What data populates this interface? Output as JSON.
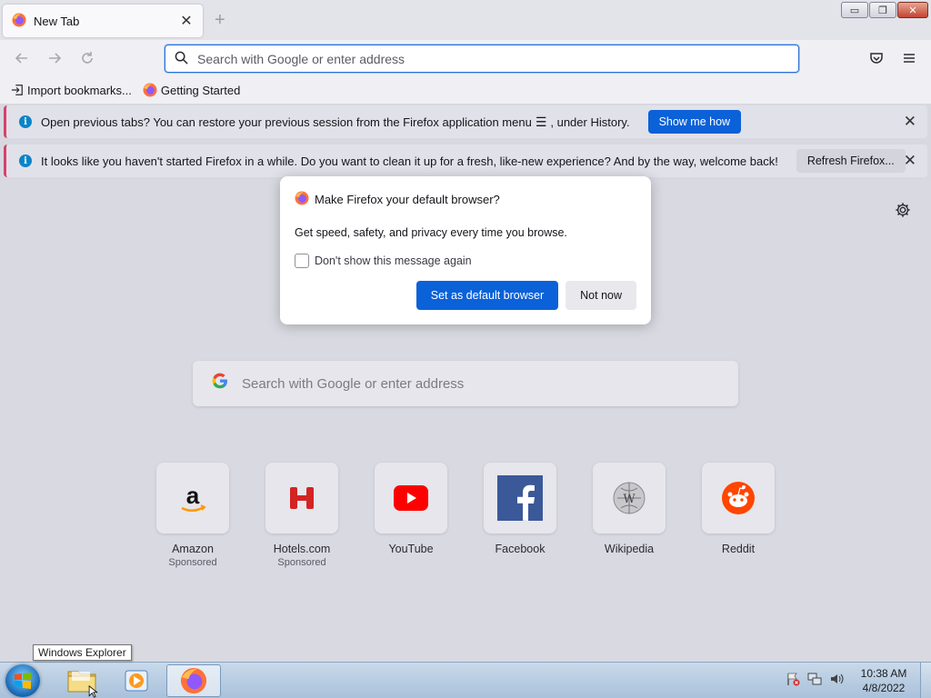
{
  "tab": {
    "title": "New Tab",
    "close": "✕",
    "new": "+"
  },
  "window_controls": {
    "minimize": "▭",
    "maximize": "❐",
    "close": "✕"
  },
  "urlbar": {
    "placeholder": "Search with Google or enter address"
  },
  "bookmarks": [
    {
      "label": "Import bookmarks...",
      "icon": "import-icon"
    },
    {
      "label": "Getting Started",
      "icon": "firefox-icon"
    }
  ],
  "notifications": [
    {
      "message": "Open previous tabs? You can restore your previous session from the Firefox application menu",
      "message_suffix": ", under History.",
      "button": "Show me how"
    },
    {
      "message": "It looks like you haven't started Firefox in a while. Do you want to clean it up for a fresh, like-new experience? And by the way, welcome back!",
      "button": "Refresh Firefox..."
    }
  ],
  "dialog": {
    "title": "Make Firefox your default browser?",
    "body": "Get speed, safety, and privacy every time you browse.",
    "checkbox_label": "Don't show this message again",
    "primary_button": "Set as default browser",
    "secondary_button": "Not now"
  },
  "page_search": {
    "placeholder": "Search with Google or enter address"
  },
  "top_sites": [
    {
      "name": "Amazon",
      "sponsored": "Sponsored"
    },
    {
      "name": "Hotels.com",
      "sponsored": "Sponsored"
    },
    {
      "name": "YouTube",
      "sponsored": ""
    },
    {
      "name": "Facebook",
      "sponsored": ""
    },
    {
      "name": "Wikipedia",
      "sponsored": ""
    },
    {
      "name": "Reddit",
      "sponsored": ""
    }
  ],
  "taskbar": {
    "tooltip": "Windows Explorer",
    "clock_time": "10:38 AM",
    "clock_date": "4/8/2022"
  },
  "colors": {
    "accent": "#0b61d8",
    "info": "#0a84c8",
    "notif_stripe": "#d4436b"
  }
}
